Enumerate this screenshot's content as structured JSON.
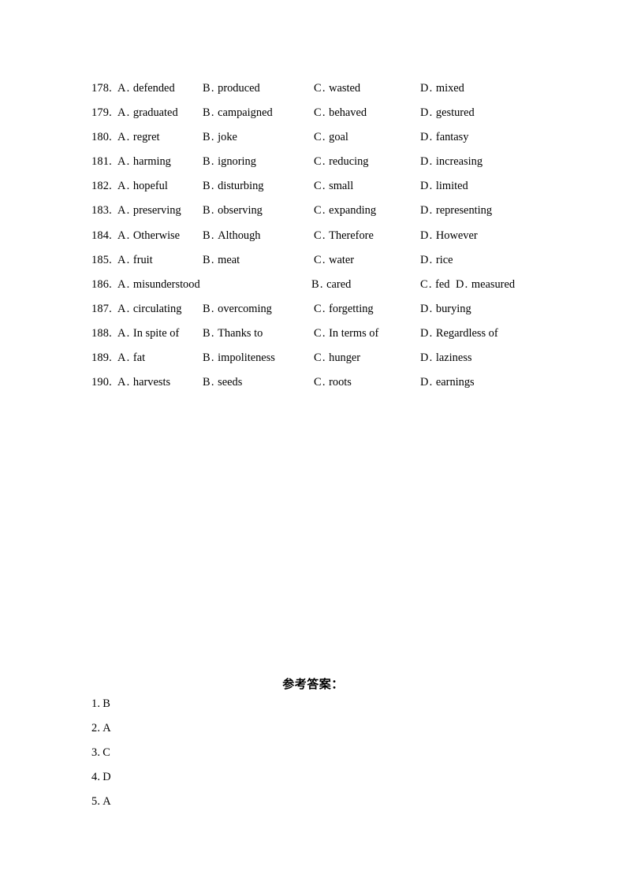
{
  "document": {
    "type": "english-exam-answer-key-page",
    "page_background": "#ffffff",
    "text_color": "#000000"
  },
  "questions": [
    {
      "number": "178.",
      "layout": "standard",
      "options": [
        {
          "letter": "A",
          "sep": ".",
          "text": "defended"
        },
        {
          "letter": "B",
          "sep": ".",
          "text": "produced"
        },
        {
          "letter": "C",
          "sep": ".",
          "text": "wasted"
        },
        {
          "letter": "D",
          "sep": ".",
          "text": "mixed"
        }
      ]
    },
    {
      "number": "179.",
      "layout": "standard",
      "options": [
        {
          "letter": "A",
          "sep": ".",
          "text": "graduated"
        },
        {
          "letter": "B",
          "sep": ".",
          "text": "campaigned"
        },
        {
          "letter": "C",
          "sep": ".",
          "text": "behaved"
        },
        {
          "letter": "D",
          "sep": ".",
          "text": "gestured"
        }
      ]
    },
    {
      "number": "180.",
      "layout": "standard",
      "options": [
        {
          "letter": "A",
          "sep": ".",
          "text": "regret"
        },
        {
          "letter": "B",
          "sep": ".",
          "text": "joke"
        },
        {
          "letter": "C",
          "sep": ".",
          "text": "goal"
        },
        {
          "letter": "D",
          "sep": ".",
          "text": "fantasy"
        }
      ]
    },
    {
      "number": "181.",
      "layout": "standard",
      "options": [
        {
          "letter": "A",
          "sep": ".",
          "text": "harming"
        },
        {
          "letter": "B",
          "sep": ".",
          "text": "ignoring"
        },
        {
          "letter": "C",
          "sep": ".",
          "text": "reducing"
        },
        {
          "letter": "D",
          "sep": ".",
          "text": "increasing"
        }
      ]
    },
    {
      "number": "182.",
      "layout": "standard",
      "options": [
        {
          "letter": "A",
          "sep": ".",
          "text": "hopeful"
        },
        {
          "letter": "B",
          "sep": ".",
          "text": "disturbing"
        },
        {
          "letter": "C",
          "sep": ".",
          "text": "small"
        },
        {
          "letter": "D",
          "sep": ".",
          "text": "limited"
        }
      ]
    },
    {
      "number": "183.",
      "layout": "standard",
      "options": [
        {
          "letter": "A",
          "sep": ".",
          "text": "preserving"
        },
        {
          "letter": "B",
          "sep": ".",
          "text": "observing"
        },
        {
          "letter": "C",
          "sep": ".",
          "text": "expanding"
        },
        {
          "letter": "D",
          "sep": ".",
          "text": "representing"
        }
      ]
    },
    {
      "number": "184.",
      "layout": "standard",
      "options": [
        {
          "letter": "A",
          "sep": ".",
          "text": "Otherwise"
        },
        {
          "letter": "B",
          "sep": ".",
          "text": "Although"
        },
        {
          "letter": "C",
          "sep": ".",
          "text": "Therefore"
        },
        {
          "letter": "D",
          "sep": ".",
          "text": "However"
        }
      ]
    },
    {
      "number": "185.",
      "layout": "standard",
      "options": [
        {
          "letter": "A",
          "sep": ".",
          "text": "fruit"
        },
        {
          "letter": "B",
          "sep": ".",
          "text": "meat"
        },
        {
          "letter": "C",
          "sep": ".",
          "text": "water"
        },
        {
          "letter": "D",
          "sep": ".",
          "text": "rice"
        }
      ]
    },
    {
      "number": "186.",
      "layout": "shifted",
      "options": [
        {
          "letter": "A",
          "sep": ".",
          "text": "misunderstood"
        },
        {
          "letter": "B",
          "sep": ".",
          "text": "cared"
        },
        {
          "letter": "C",
          "sep": ".",
          "text": "fed"
        },
        {
          "letter": "D",
          "sep": ".",
          "text": "measured"
        }
      ]
    },
    {
      "number": "187.",
      "layout": "standard",
      "options": [
        {
          "letter": "A",
          "sep": ".",
          "text": "circulating"
        },
        {
          "letter": "B",
          "sep": ".",
          "text": "overcoming"
        },
        {
          "letter": "C",
          "sep": ".",
          "text": "forgetting"
        },
        {
          "letter": "D",
          "sep": ".",
          "text": "burying"
        }
      ]
    },
    {
      "number": "188.",
      "layout": "standard",
      "options": [
        {
          "letter": "A",
          "sep": ".",
          "text": "In spite of"
        },
        {
          "letter": "B",
          "sep": ".",
          "text": "Thanks to"
        },
        {
          "letter": "C",
          "sep": ".",
          "text": "In terms of"
        },
        {
          "letter": "D",
          "sep": ".",
          "text": "Regardless of"
        }
      ]
    },
    {
      "number": "189.",
      "layout": "standard",
      "options": [
        {
          "letter": "A",
          "sep": ".",
          "text": "fat"
        },
        {
          "letter": "B",
          "sep": ".",
          "text": "impoliteness"
        },
        {
          "letter": "C",
          "sep": ".",
          "text": "hunger"
        },
        {
          "letter": "D",
          "sep": ".",
          "text": "laziness"
        }
      ]
    },
    {
      "number": "190.",
      "layout": "standard",
      "options": [
        {
          "letter": "A",
          "sep": ".",
          "text": "harvests"
        },
        {
          "letter": "B",
          "sep": ".",
          "text": "seeds"
        },
        {
          "letter": "C",
          "sep": ".",
          "text": "roots"
        },
        {
          "letter": "D",
          "sep": ".",
          "text": "earnings"
        }
      ]
    }
  ],
  "answer_key": {
    "heading": "参考答案：",
    "items": [
      {
        "number": "1.",
        "answer": "B"
      },
      {
        "number": "2.",
        "answer": "A"
      },
      {
        "number": "3.",
        "answer": "C"
      },
      {
        "number": "4.",
        "answer": "D"
      },
      {
        "number": "5.",
        "answer": "A"
      }
    ]
  }
}
